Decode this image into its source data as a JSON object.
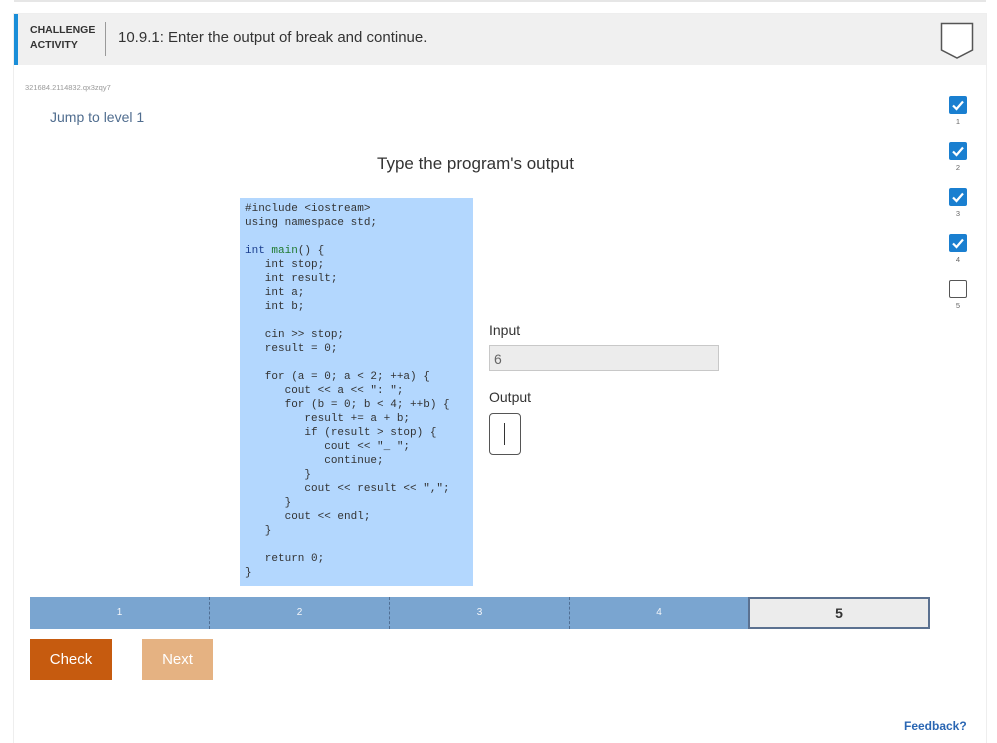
{
  "header": {
    "label_line1": "CHALLENGE",
    "label_line2": "ACTIVITY",
    "title": "10.9.1: Enter the output of break and continue."
  },
  "activity_id": "321684.2114832.qx3zqy7",
  "jump_link": "Jump to level 1",
  "prompt": "Type the program's output",
  "code_lines": [
    {
      "parts": [
        {
          "t": "#include <iostream>"
        }
      ]
    },
    {
      "parts": [
        {
          "t": "using namespace std;"
        }
      ]
    },
    {
      "parts": [
        {
          "t": ""
        }
      ]
    },
    {
      "parts": [
        {
          "t": "int ",
          "c": "kw"
        },
        {
          "t": "main",
          "c": "fn"
        },
        {
          "t": "() {"
        }
      ]
    },
    {
      "parts": [
        {
          "t": "   int stop;"
        }
      ]
    },
    {
      "parts": [
        {
          "t": "   int result;"
        }
      ]
    },
    {
      "parts": [
        {
          "t": "   int a;"
        }
      ]
    },
    {
      "parts": [
        {
          "t": "   int b;"
        }
      ]
    },
    {
      "parts": [
        {
          "t": ""
        }
      ]
    },
    {
      "parts": [
        {
          "t": "   cin >> stop;"
        }
      ]
    },
    {
      "parts": [
        {
          "t": "   result = 0;"
        }
      ]
    },
    {
      "parts": [
        {
          "t": ""
        }
      ]
    },
    {
      "parts": [
        {
          "t": "   for (a = 0; a < 2; ++a) {"
        }
      ]
    },
    {
      "parts": [
        {
          "t": "      cout << a << \": \";"
        }
      ]
    },
    {
      "parts": [
        {
          "t": "      for (b = 0; b < 4; ++b) {"
        }
      ]
    },
    {
      "parts": [
        {
          "t": "         result += a + b;"
        }
      ]
    },
    {
      "parts": [
        {
          "t": "         if (result > stop) {"
        }
      ]
    },
    {
      "parts": [
        {
          "t": "            cout << \"_ \";"
        }
      ]
    },
    {
      "parts": [
        {
          "t": "            continue;"
        }
      ]
    },
    {
      "parts": [
        {
          "t": "         }"
        }
      ]
    },
    {
      "parts": [
        {
          "t": "         cout << result << \",\";"
        }
      ]
    },
    {
      "parts": [
        {
          "t": "      }"
        }
      ]
    },
    {
      "parts": [
        {
          "t": "      cout << endl;"
        }
      ]
    },
    {
      "parts": [
        {
          "t": "   }"
        }
      ]
    },
    {
      "parts": [
        {
          "t": ""
        }
      ]
    },
    {
      "parts": [
        {
          "t": "   return 0;"
        }
      ]
    },
    {
      "parts": [
        {
          "t": "}"
        }
      ]
    }
  ],
  "input": {
    "label": "Input",
    "value": "6"
  },
  "output": {
    "label": "Output",
    "value": ""
  },
  "progress": {
    "segments": [
      "1",
      "2",
      "3",
      "4",
      "5"
    ],
    "current": "5"
  },
  "buttons": {
    "check": "Check",
    "next": "Next"
  },
  "feedback": "Feedback?",
  "levels": [
    {
      "num": "1",
      "completed": true
    },
    {
      "num": "2",
      "completed": true
    },
    {
      "num": "3",
      "completed": true
    },
    {
      "num": "4",
      "completed": true
    },
    {
      "num": "5",
      "completed": false
    }
  ],
  "colors": {
    "accent": "#1a8ed8",
    "check_button": "#c65b0f",
    "next_button": "#e5b282",
    "code_background": "#b3d7fe",
    "progress_fill": "#7aa5d0",
    "level_done": "#1a7fd0"
  }
}
